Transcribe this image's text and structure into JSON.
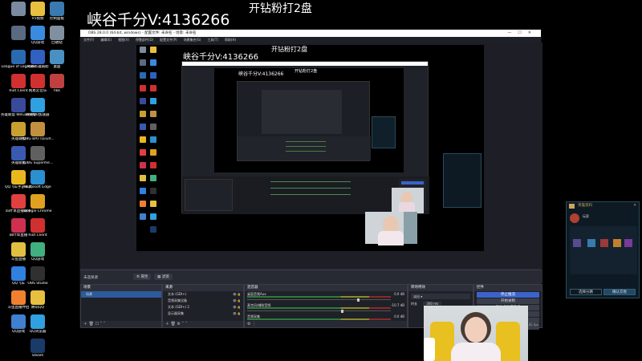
{
  "overlay": {
    "main_caption": "峡谷千分V:4136266",
    "sub_caption": "开钻粉打2盘",
    "nested_caption": "峡谷千分V:4136266",
    "nested_sub_caption": "开钻粉打2盘"
  },
  "desktop": {
    "column1": [
      {
        "label": "",
        "color": "#7a8aa0"
      },
      {
        "label": "",
        "color": "#5a6a80"
      },
      {
        "label": "League of Legends",
        "color": "#2a6ab0"
      },
      {
        "label": "Riot Client",
        "color": "#d03030"
      },
      {
        "label": "英雄联盟 WeGame版",
        "color": "#3a4a9a"
      },
      {
        "label": "英雄联盟",
        "color": "#c9a030"
      },
      {
        "label": "英雄联盟",
        "color": "#3a5ab0"
      },
      {
        "label": "QQ飞车手游工具",
        "color": "#e8b820"
      },
      {
        "label": "四叶草直播助手",
        "color": "#e04040"
      },
      {
        "label": "四叶草直播",
        "color": "#d03050"
      },
      {
        "label": "斗鱼直播",
        "color": "#e0c040"
      },
      {
        "label": "QQ飞车",
        "color": "#3080e0"
      },
      {
        "label": "斗鱼直播伴侣",
        "color": "#f08030"
      },
      {
        "label": "QQ游戏",
        "color": "#4080d0"
      }
    ],
    "column2": [
      {
        "label": "V5视频",
        "color": "#e8c040"
      },
      {
        "label": "QQ游戏",
        "color": "#3a8ae0"
      },
      {
        "label": "风暴英雄辅助",
        "color": "#3060c0"
      },
      {
        "label": "网易云音乐",
        "color": "#d03030"
      },
      {
        "label": "网易UU加速器",
        "color": "#30a0e0"
      },
      {
        "label": "PUBG BATTLEGR...",
        "color": "#c09040"
      },
      {
        "label": "PUBG Superme...",
        "color": "#606060"
      },
      {
        "label": "Microsoft Edge",
        "color": "#2a90d0"
      },
      {
        "label": "Google Chrome",
        "color": "#e0a020"
      },
      {
        "label": "Riot Client",
        "color": "#d03030"
      },
      {
        "label": "QQ游戏",
        "color": "#40b080"
      },
      {
        "label": "OBS Studio",
        "color": "#303030"
      },
      {
        "label": "腾讯QQ",
        "color": "#e8c040"
      },
      {
        "label": "QQ浏览器",
        "color": "#30a0e0"
      },
      {
        "label": "Steam",
        "color": "#1a3a6a"
      }
    ],
    "column3": [
      {
        "label": "控制面板",
        "color": "#3a7ab0"
      },
      {
        "label": "回收站",
        "color": "#8090a0"
      },
      {
        "label": "桌面",
        "color": "#4a90c0"
      },
      {
        "label": "hkk",
        "color": "#c04040"
      }
    ]
  },
  "obs": {
    "title": "OBS 28.0.0 (64-bit, windows) - 配置文件: 未命名 - 场景: 未命名",
    "menu": [
      "文件(F)",
      "编辑(E)",
      "视图(V)",
      "停靠部件(D)",
      "配置文件(P)",
      "场景集合(S)",
      "工具(T)",
      "帮助(H)"
    ],
    "toolbar": {
      "source_label": "未选择源",
      "properties": "属性",
      "filters": "滤镜"
    },
    "scenes": {
      "title": "场景",
      "items": [
        "场景"
      ]
    },
    "sources": {
      "title": "来源",
      "items": [
        "文本 (GDI+)",
        "音频采集设备",
        "文本 (GDI+) 2",
        "显示器采集"
      ]
    },
    "mixer": {
      "title": "混音器",
      "channels": [
        {
          "name": "桌面音频Aux",
          "db": "0.0 dB"
        },
        {
          "name": "麦克风/辅助音频",
          "db": "-10.7 dB"
        },
        {
          "name": "音频采集",
          "db": "0.0 dB"
        }
      ]
    },
    "transitions": {
      "title": "转场特效",
      "type": "淡出",
      "duration_label": "时长",
      "duration": "300 ms"
    },
    "controls": {
      "title": "控件",
      "buttons": [
        "停止推流",
        "开始录制",
        "启动虚拟摄像机",
        "工作室模式",
        "设置",
        "退出"
      ]
    },
    "statusbar": "LIVE 00:00:00  CPU: 6.3%, 60.00 fps"
  },
  "game_panel": {
    "title": "英雄资料",
    "player": "玩家",
    "btn_left": "选择分路",
    "btn_right": "确认交易"
  },
  "colors": {
    "obs_bg": "#272a33",
    "obs_dock": "#1f2128",
    "obs_accent": "#3b63c9",
    "game_gold": "#c9a85a"
  }
}
